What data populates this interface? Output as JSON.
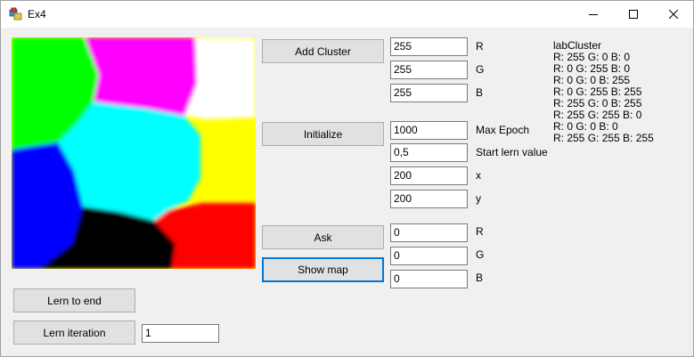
{
  "window": {
    "title": "Ex4"
  },
  "buttons": {
    "add_cluster": "Add Cluster",
    "initialize": "Initialize",
    "ask": "Ask",
    "show_map": "Show map",
    "lern_to_end": "Lern to end",
    "lern_iteration": "Lern iteration"
  },
  "cluster_inputs": [
    {
      "value": "255",
      "label": "R"
    },
    {
      "value": "255",
      "label": "G"
    },
    {
      "value": "255",
      "label": "B"
    }
  ],
  "init_inputs": [
    {
      "value": "1000",
      "label": "Max Epoch"
    },
    {
      "value": "0,5",
      "label": "Start lern value"
    },
    {
      "value": "200",
      "label": "x"
    },
    {
      "value": "200",
      "label": "y"
    }
  ],
  "ask_inputs": [
    {
      "value": "0",
      "label": "R"
    },
    {
      "value": "0",
      "label": "G"
    },
    {
      "value": "0",
      "label": "B"
    }
  ],
  "iteration_input": "1",
  "lab_cluster": {
    "title": "labCluster",
    "lines": [
      "R: 255 G: 0 B: 0",
      "R: 0 G: 255 B: 0",
      "R: 0 G: 0 B: 255",
      "R: 0 G: 255 B: 255",
      "R: 255 G: 0 B: 255",
      "R: 255 G: 255 B: 0",
      "R: 0 G: 0 B: 0",
      "R: 255 G: 255 B: 255"
    ]
  },
  "colors": {
    "green": "#00ff00",
    "magenta": "#ff00ff",
    "white": "#ffffff",
    "cyan": "#00ffff",
    "yellow": "#ffff00",
    "blue": "#0000ff",
    "black": "#000000",
    "red": "#ff0000",
    "accent": "#0078d7"
  }
}
